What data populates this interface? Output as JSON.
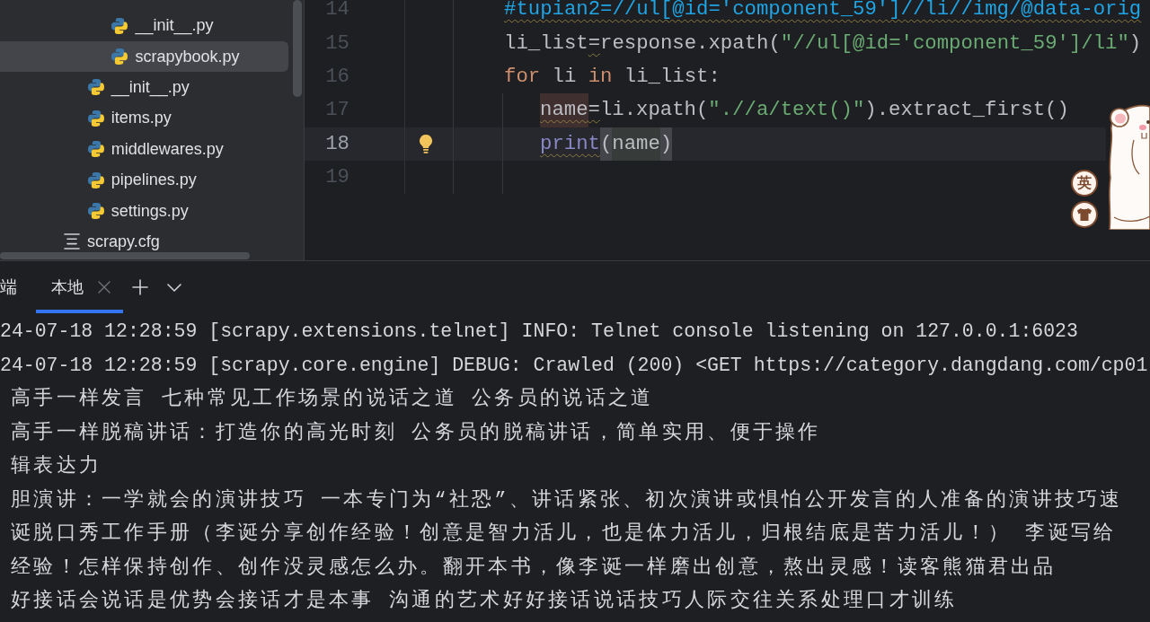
{
  "project_tree": [
    {
      "children": [
        {
          "children": [
            {
              "name": "__init__.py",
              "kind": "python",
              "selected": false
            },
            {
              "name": "scrapybook.py",
              "kind": "python",
              "selected": true
            }
          ]
        },
        {
          "name": "__init__.py",
          "kind": "python",
          "selected": false
        },
        {
          "name": "items.py",
          "kind": "python",
          "selected": false
        },
        {
          "name": "middlewares.py",
          "kind": "python",
          "selected": false
        },
        {
          "name": "pipelines.py",
          "kind": "python",
          "selected": false
        },
        {
          "name": "settings.py",
          "kind": "python",
          "selected": false
        }
      ]
    },
    {
      "name": "scrapy.cfg",
      "kind": "config",
      "selected": false
    }
  ],
  "editor": {
    "lines": [
      {
        "number": "14",
        "current": false,
        "bulb": false,
        "tokens": [
          {
            "text": "#tupian2=//ul[@id='component_59']//li//img/@data-orig",
            "kind": "comment",
            "warning": true
          }
        ]
      },
      {
        "number": "15",
        "current": false,
        "bulb": false,
        "tokens": [
          {
            "text": "li_list",
            "kind": "plain",
            "warning": false
          },
          {
            "text": "=",
            "kind": "plain",
            "warning": true
          },
          {
            "text": "response.xpath(",
            "kind": "plain",
            "warning": false
          },
          {
            "text": "\"//ul[@id='component_59']/li\"",
            "kind": "string",
            "warning": false
          },
          {
            "text": ")",
            "kind": "plain",
            "warning": false
          }
        ]
      },
      {
        "number": "16",
        "current": false,
        "bulb": false,
        "tokens": [
          {
            "text": "for",
            "kind": "keyword",
            "warning": false
          },
          {
            "text": " li ",
            "kind": "plain",
            "warning": false
          },
          {
            "text": "in",
            "kind": "keyword",
            "warning": false
          },
          {
            "text": " li_list:",
            "kind": "plain",
            "warning": false
          }
        ],
        "children": [
          {
            "number": "17",
            "current": false,
            "bulb": false,
            "tokens": [
              {
                "text": "name",
                "kind": "assignment",
                "warning": true
              },
              {
                "text": "=",
                "kind": "plain",
                "warning": true
              },
              {
                "text": "li.xpath(",
                "kind": "plain",
                "warning": false
              },
              {
                "text": "\".//a/text()\"",
                "kind": "string",
                "warning": false
              },
              {
                "text": ").extract_first()",
                "kind": "plain",
                "warning": false
              }
            ]
          },
          {
            "number": "18",
            "current": true,
            "bulb": true,
            "tokens": [
              {
                "text": "print",
                "kind": "builtin",
                "warning": true
              },
              {
                "text": "(",
                "kind": "brace",
                "warning": false
              },
              {
                "text": "name",
                "kind": "reference",
                "warning": false
              },
              {
                "text": ")",
                "kind": "brace",
                "warning": false
              }
            ]
          },
          {
            "number": "19",
            "current": false,
            "bulb": false
          }
        ]
      }
    ]
  },
  "terminal": {
    "title": "端",
    "tabs": [
      {
        "label": "本地",
        "selected": true
      }
    ],
    "lines": [
      {
        "kind": "log",
        "text": "24-07-18 12:28:59 [scrapy.extensions.telnet] INFO: Telnet console listening on 127.0.0.1:6023"
      },
      {
        "kind": "log",
        "text": "24-07-18 12:28:59 [scrapy.core.engine] DEBUG: Crawled (200) <GET https://category.dangdang.com/cp01"
      },
      {
        "kind": "output",
        "text": "高手一样发言 七种常见工作场景的说话之道 公务员的说话之道"
      },
      {
        "kind": "output",
        "text": "高手一样脱稿讲话：打造你的高光时刻 公务员的脱稿讲话，简单实用、便于操作"
      },
      {
        "kind": "output",
        "text": "辑表达力"
      },
      {
        "kind": "output",
        "text": "胆演讲：一学就会的演讲技巧 一本专门为“社恐”、讲话紧张、初次演讲或惧怕公开发言的人准备的演讲技巧速"
      },
      {
        "kind": "output",
        "text": "诞脱口秀工作手册（李诞分享创作经验！创意是智力活儿，也是体力活儿，归根结底是苦力活儿！） 李诞写给"
      },
      {
        "kind": "output",
        "text": "经验！怎样保持创作、创作没灵感怎么办。翻开本书，像李诞一样磨出创意，熬出灵感！读客熊猫君出品"
      },
      {
        "kind": "output",
        "text": "好接话会说话是优势会接话才是本事 沟通的艺术好好接话说话技巧人际交往关系处理口才训练"
      }
    ]
  },
  "ime_toolbar": {
    "mode": "英"
  }
}
